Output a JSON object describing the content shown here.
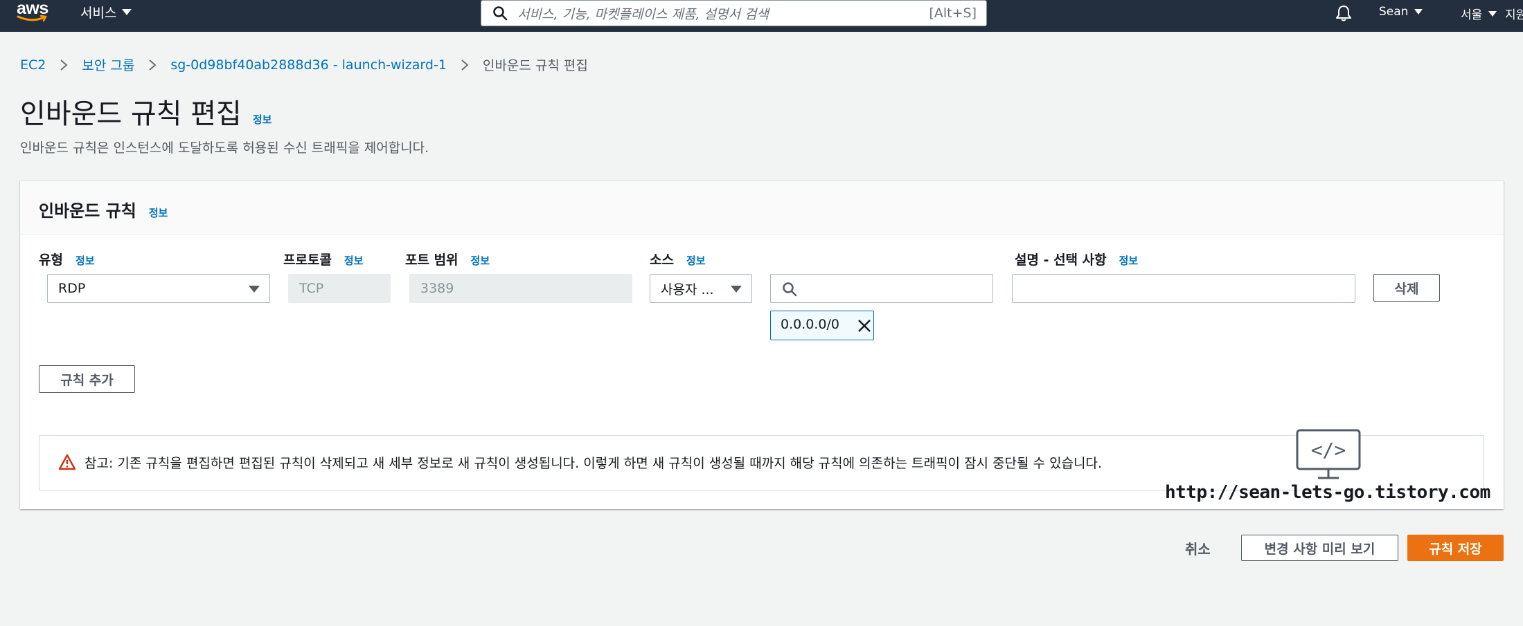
{
  "topnav": {
    "logo_text": "aws",
    "services_label": "서비스",
    "search_placeholder": "서비스, 기능, 마켓플레이스 제품, 설명서 검색",
    "search_shortcut": "[Alt+S]",
    "user_label": "Sean",
    "region_label": "서울",
    "support_label": "지원"
  },
  "breadcrumb": {
    "items": [
      "EC2",
      "보안 그룹",
      "sg-0d98bf40ab2888d36 - launch-wizard-1"
    ],
    "current": "인바운드 규칙 편집"
  },
  "header": {
    "title": "인바운드 규칙 편집",
    "info": "정보",
    "description": "인바운드 규칙은 인스턴스에 도달하도록 허용된 수신 트래픽을 제어합니다."
  },
  "rules_panel": {
    "title": "인바운드 규칙",
    "info": "정보",
    "columns": [
      {
        "label": "유형",
        "info": "정보"
      },
      {
        "label": "프로토콜",
        "info": "정보"
      },
      {
        "label": "포트 범위",
        "info": "정보"
      },
      {
        "label": "소스",
        "info": "정보"
      },
      {
        "label": "설명 - 선택 사항",
        "info": "정보"
      }
    ],
    "rules": [
      {
        "type": "RDP",
        "protocol": "TCP",
        "port_range": "3389",
        "source_type": "사용자 ...",
        "source_search_value": "",
        "source_tokens": [
          "0.0.0.0/0"
        ],
        "description": "",
        "delete_label": "삭제"
      }
    ],
    "add_rule_label": "규칙 추가",
    "alert_text": "참고: 기존 규칙을 편집하면 편집된 규칙이 삭제되고 새 세부 정보로 새 규칙이 생성됩니다. 이렇게 하면 새 규칙이 생성될 때까지 해당 규칙에 의존하는 트래픽이 잠시 중단될 수 있습니다."
  },
  "watermark": {
    "monitor_text": "</>",
    "url": "http://sean-lets-go.tistory.com"
  },
  "footer": {
    "cancel_label": "취소",
    "preview_label": "변경 사항 미리 보기",
    "save_label": "규칙 저장"
  },
  "colors": {
    "nav_bg": "#232f3e",
    "link": "#0073bb",
    "primary": "#ec7211",
    "page_bg": "#f2f3f3",
    "warning": "#d13212"
  },
  "icons": [
    "search-icon",
    "bell-icon",
    "chevron-right-icon",
    "caret-down-icon",
    "close-icon",
    "warning-icon",
    "monitor-icon"
  ]
}
